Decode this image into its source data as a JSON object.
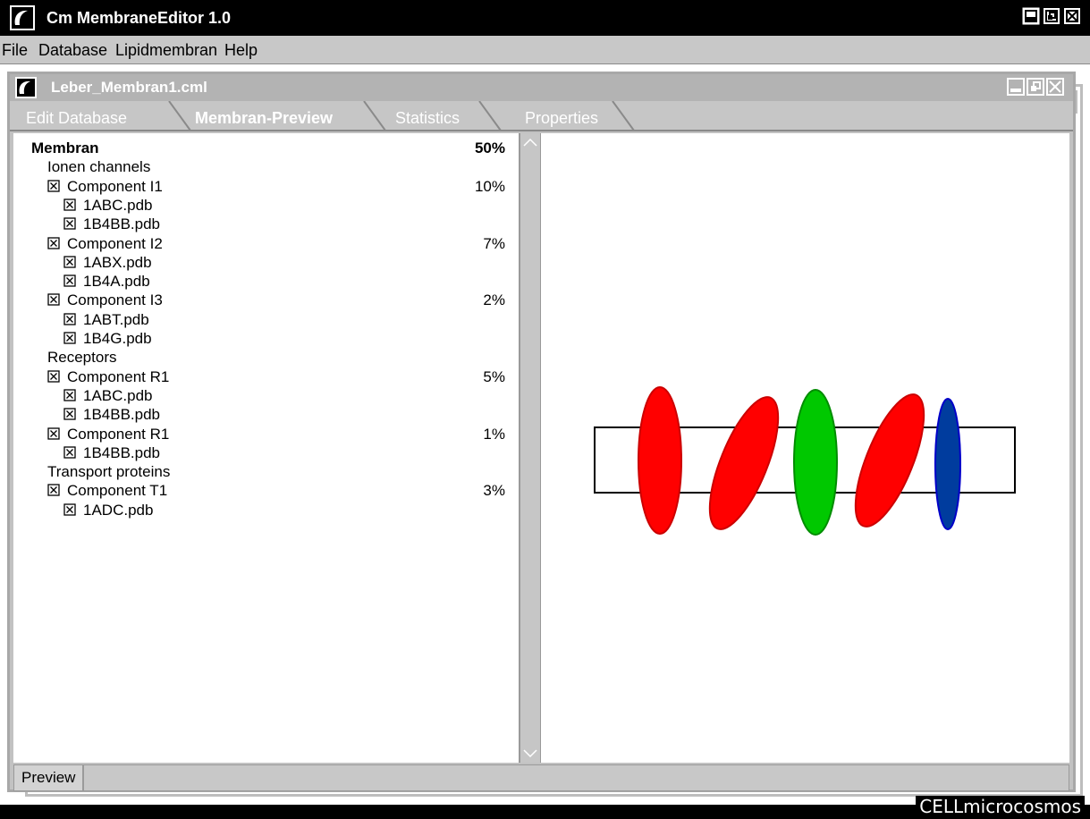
{
  "app": {
    "title": "Cm MembraneEditor 1.0",
    "logo_text": "CELLmicrocosmos"
  },
  "menu": [
    "File",
    "Database",
    "Lipidmembran",
    "Help"
  ],
  "document": {
    "title": "Leber_Membran1.cml"
  },
  "tabs": [
    "Edit Database",
    "Membran-Preview",
    "Statistics",
    "Properties"
  ],
  "active_tab": "Membran-Preview",
  "tree": [
    {
      "label": "Membran",
      "pct": "50%",
      "level": 0,
      "bold": true,
      "checkbox": false
    },
    {
      "label": "Ionen channels",
      "pct": "",
      "level": 1,
      "bold": false,
      "checkbox": false
    },
    {
      "label": "Component I1",
      "pct": "10%",
      "level": 2,
      "bold": false,
      "checkbox": true
    },
    {
      "label": "1ABC.pdb",
      "pct": "",
      "level": 3,
      "bold": false,
      "checkbox": true
    },
    {
      "label": "1B4BB.pdb",
      "pct": "",
      "level": 3,
      "bold": false,
      "checkbox": true
    },
    {
      "label": "Component I2",
      "pct": "7%",
      "level": 2,
      "bold": false,
      "checkbox": true
    },
    {
      "label": "1ABX.pdb",
      "pct": "",
      "level": 3,
      "bold": false,
      "checkbox": true
    },
    {
      "label": "1B4A.pdb",
      "pct": "",
      "level": 3,
      "bold": false,
      "checkbox": true
    },
    {
      "label": "Component I3",
      "pct": "2%",
      "level": 2,
      "bold": false,
      "checkbox": true
    },
    {
      "label": "1ABT.pdb",
      "pct": "",
      "level": 3,
      "bold": false,
      "checkbox": true
    },
    {
      "label": "1B4G.pdb",
      "pct": "",
      "level": 3,
      "bold": false,
      "checkbox": true
    },
    {
      "label": "Receptors",
      "pct": "",
      "level": 1,
      "bold": false,
      "checkbox": false
    },
    {
      "label": "Component R1",
      "pct": "5%",
      "level": 2,
      "bold": false,
      "checkbox": true
    },
    {
      "label": "1ABC.pdb",
      "pct": "",
      "level": 3,
      "bold": false,
      "checkbox": true
    },
    {
      "label": "1B4BB.pdb",
      "pct": "",
      "level": 3,
      "bold": false,
      "checkbox": true
    },
    {
      "label": "Component R1",
      "pct": "1%",
      "level": 2,
      "bold": false,
      "checkbox": true
    },
    {
      "label": "1B4BB.pdb",
      "pct": "",
      "level": 3,
      "bold": false,
      "checkbox": true
    },
    {
      "label": "Transport proteins",
      "pct": "",
      "level": 1,
      "bold": false,
      "checkbox": false
    },
    {
      "label": "Component T1",
      "pct": "3%",
      "level": 2,
      "bold": false,
      "checkbox": true
    },
    {
      "label": "1ADC.pdb",
      "pct": "",
      "level": 3,
      "bold": false,
      "checkbox": true
    }
  ],
  "preview": {
    "proteins": [
      {
        "color": "#ff0000",
        "stroke": "#cc0000",
        "tilt_deg": 0
      },
      {
        "color": "#ff0000",
        "stroke": "#cc0000",
        "tilt_deg": 22
      },
      {
        "color": "#00c800",
        "stroke": "#008c00",
        "tilt_deg": 0
      },
      {
        "color": "#ff0000",
        "stroke": "#cc0000",
        "tilt_deg": 22
      },
      {
        "color": "#003c9e",
        "stroke": "#0000c8",
        "tilt_deg": 0
      }
    ]
  },
  "statusbar": {
    "tab": "Preview"
  },
  "colors": {
    "chrome_gray": "#c6c6c6",
    "title_black": "#000000",
    "tab_text": "#ffffff"
  }
}
